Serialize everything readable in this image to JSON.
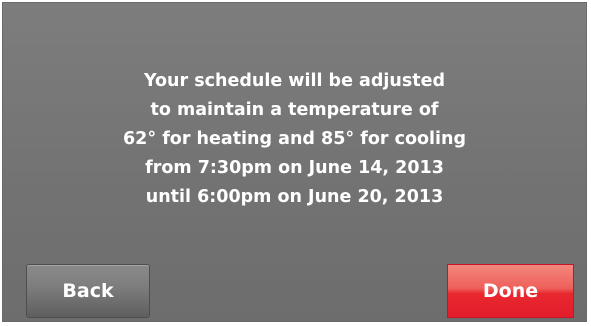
{
  "message": {
    "lines": [
      "Your schedule will be adjusted",
      "to maintain a temperature of",
      "62° for heating and 85° for cooling",
      "from 7:30pm on June 14, 2013",
      "until 6:00pm on June 20, 2013"
    ]
  },
  "buttons": {
    "back_label": "Back",
    "done_label": "Done"
  },
  "colors": {
    "screen_background": "#737373",
    "text": "#ffffff",
    "back_button": "#7e7e7e",
    "done_button": "#e8282f"
  }
}
